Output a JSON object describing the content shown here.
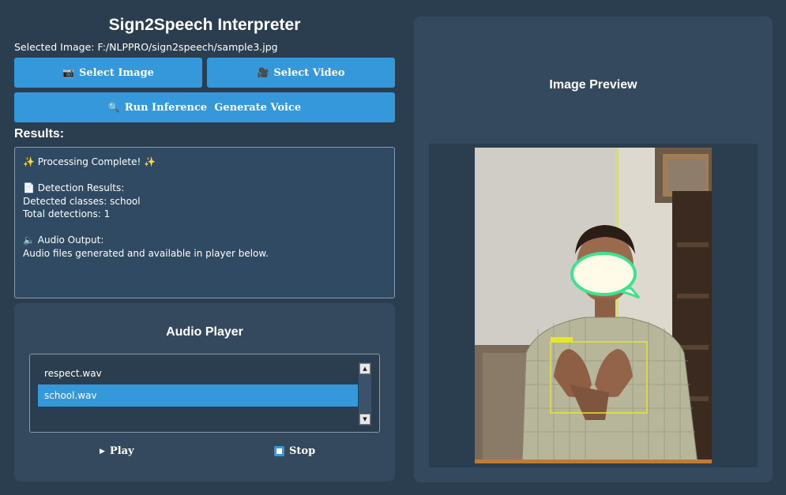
{
  "app": {
    "title": "Sign2Speech Interpreter",
    "selected_image": "Selected Image: F:/NLPPRO/sign2speech/sample3.jpg"
  },
  "buttons": {
    "select_image": "Select Image",
    "select_video": "Select Video",
    "run_inference": "Run Inference  Generate Voice"
  },
  "results": {
    "label": "Results:",
    "lines": [
      "✨ Processing Complete! ✨",
      "",
      "📄 Detection Results:",
      "Detected classes: school",
      "Total detections: 1",
      "",
      "🔈 Audio Output:",
      "Audio files generated and available in player below."
    ]
  },
  "audio_player": {
    "title": "Audio Player",
    "files": [
      "respect.wav",
      "school.wav"
    ],
    "selected": "school.wav",
    "play_label": "Play",
    "stop_label": "Stop"
  },
  "preview": {
    "title": "Image Preview"
  },
  "colors": {
    "background": "#2b3e50",
    "panel": "#34495e",
    "accent": "#3498db",
    "detection_box": "#e6e62a"
  },
  "icons": {
    "select_image": "camera-icon",
    "select_video": "video-icon",
    "run_inference": "magnifier-icon",
    "play": "play-icon",
    "stop": "stop-icon"
  }
}
